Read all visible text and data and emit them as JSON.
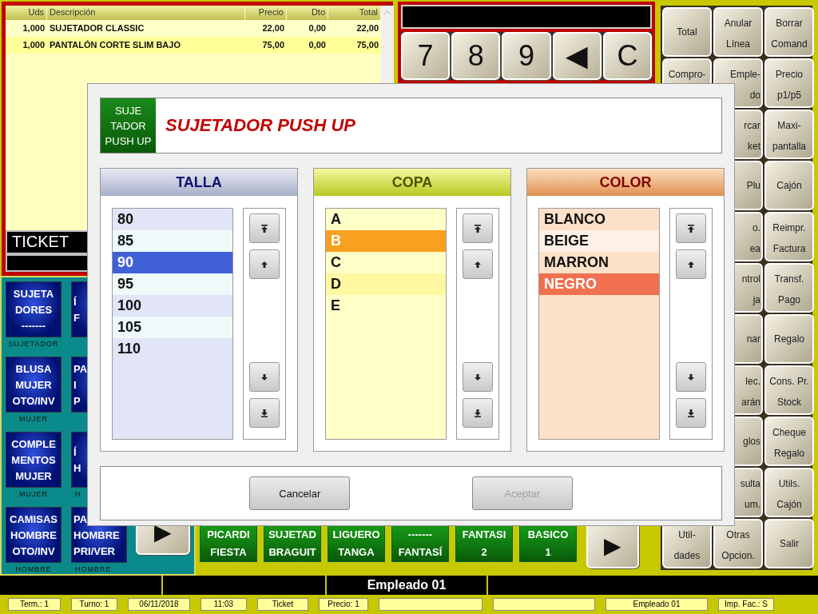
{
  "ticket": {
    "columns": [
      "Uds",
      "Descripción",
      "Precio",
      "Dto",
      "Total"
    ],
    "rows": [
      {
        "uds": "1,000",
        "descripcion": "SUJETADOR CLASSIC",
        "precio": "22,00",
        "dto": "0,00",
        "total": "22,00"
      },
      {
        "uds": "1,000",
        "descripcion": "PANTALÓN CORTE SLIM BAJO",
        "precio": "75,00",
        "dto": "0,00",
        "total": "75,00"
      }
    ],
    "label": "TICKET"
  },
  "numpad": {
    "keys": [
      "7",
      "8",
      "9",
      "◀",
      "C"
    ]
  },
  "categories": [
    {
      "lines": [
        "SUJETA",
        "DORES",
        "-------"
      ],
      "caption": "SUJETADOR"
    },
    {
      "lines": [
        "Í",
        "F"
      ]
    },
    {
      "lines": [
        "BLUSA",
        "MUJER",
        "OTO/INV"
      ],
      "caption": "MUJER"
    },
    {
      "lines": [
        "PA",
        "I",
        "P"
      ]
    },
    {
      "lines": [
        "COMPLE",
        "MENTOS",
        "MUJER"
      ],
      "caption": "MUJER"
    },
    {
      "lines": [
        "Í",
        "H"
      ],
      "caption": "H"
    },
    {
      "lines": [
        "CAMISAS",
        "HOMBRE",
        "OTO/INV"
      ],
      "caption": "HOMBRE"
    },
    {
      "lines": [
        "PA",
        "HOMBRE",
        "PRI/VER"
      ],
      "caption": "HOMBRE"
    }
  ],
  "category_next": "▶",
  "products": [
    {
      "lines": [
        "PICARDI",
        "FIESTA"
      ]
    },
    {
      "lines": [
        "SUJETAD",
        "BRAGUIT"
      ]
    },
    {
      "lines": [
        "LIGUERO",
        "TANGA"
      ]
    },
    {
      "lines": [
        "-------",
        "FANTASÍ"
      ]
    },
    {
      "lines": [
        "FANTASI",
        "2"
      ]
    },
    {
      "lines": [
        "BASICO",
        "1"
      ]
    }
  ],
  "products_next": "▶",
  "functions": [
    [
      {
        "lines": [
          "Total"
        ]
      },
      {
        "lines": [
          "Compro-"
        ]
      },
      {
        "lines": [
          "Util-",
          "dades"
        ]
      }
    ],
    [
      {
        "lines": [
          "Anular",
          "Línea"
        ]
      },
      {
        "lines": [
          "Emple-",
          "do"
        ]
      },
      {
        "lines": [
          "rcar",
          "ket"
        ]
      },
      {
        "lines": [
          "Plu"
        ]
      },
      {
        "lines": [
          "o.",
          "ea"
        ]
      },
      {
        "lines": [
          "ntrol",
          "ja"
        ]
      },
      {
        "lines": [
          "nar"
        ]
      },
      {
        "lines": [
          "lec.",
          "arán"
        ]
      },
      {
        "lines": [
          "glos"
        ]
      },
      {
        "lines": [
          "sulta",
          "um."
        ]
      },
      {
        "lines": [
          "Otras",
          "Opcion."
        ]
      }
    ],
    [
      {
        "lines": [
          "Borrar",
          "Comand"
        ]
      },
      {
        "lines": [
          "Precio",
          "p1/p5"
        ]
      },
      {
        "lines": [
          "Maxi-",
          "pantalla"
        ]
      },
      {
        "lines": [
          "Cajón"
        ]
      },
      {
        "lines": [
          "Reimpr.",
          "Factura"
        ]
      },
      {
        "lines": [
          "Transf.",
          "Pago"
        ]
      },
      {
        "lines": [
          "Regalo"
        ]
      },
      {
        "lines": [
          "Cons. Pr.",
          "Stock"
        ]
      },
      {
        "lines": [
          "Cheque",
          "Regalo"
        ]
      },
      {
        "lines": [
          "Utils.",
          "Cajón"
        ]
      },
      {
        "lines": [
          "Salir"
        ]
      }
    ]
  ],
  "operator_bar": {
    "employee": "Empleado 01"
  },
  "status_bar": [
    {
      "kind": "text",
      "text": "Term.: 1"
    },
    {
      "kind": "text",
      "text": "Turno: 1"
    },
    {
      "kind": "text",
      "text": "06/11/2018"
    },
    {
      "kind": "text",
      "text": "11:03"
    },
    {
      "kind": "text",
      "text": "Ticket"
    },
    {
      "kind": "text",
      "text": "Precio: 1"
    },
    {
      "kind": "blank"
    },
    {
      "kind": "blank"
    },
    {
      "kind": "text",
      "text": "Empleado 01"
    },
    {
      "kind": "text",
      "text": "Imp. Fac.: S"
    }
  ],
  "dialog": {
    "product_tile": [
      "SUJE",
      "TADOR",
      "PUSH UP"
    ],
    "title": "SUJETADOR PUSH UP",
    "groups": [
      {
        "kind": "talla",
        "title": "TALLA",
        "options": [
          {
            "label": "80",
            "selected": false
          },
          {
            "label": "85",
            "selected": false
          },
          {
            "label": "90",
            "selected": true
          },
          {
            "label": "95",
            "selected": false
          },
          {
            "label": "100",
            "selected": false
          },
          {
            "label": "105",
            "selected": false
          },
          {
            "label": "110",
            "selected": false
          }
        ]
      },
      {
        "kind": "copa",
        "title": "COPA",
        "options": [
          {
            "label": "A",
            "selected": false
          },
          {
            "label": "B",
            "selected": true
          },
          {
            "label": "C",
            "selected": false
          },
          {
            "label": "D",
            "selected": false
          },
          {
            "label": "E",
            "selected": false
          }
        ]
      },
      {
        "kind": "color",
        "title": "COLOR",
        "options": [
          {
            "label": "BLANCO",
            "selected": false
          },
          {
            "label": "BEIGE",
            "selected": false
          },
          {
            "label": "MARRON",
            "selected": false
          },
          {
            "label": "NEGRO",
            "selected": true
          }
        ]
      }
    ],
    "buttons": [
      {
        "label": "Cancelar",
        "disabled": false
      },
      {
        "label": "Aceptar",
        "disabled": true
      }
    ]
  }
}
